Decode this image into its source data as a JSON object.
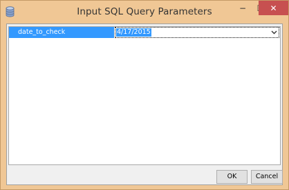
{
  "window": {
    "title": "Input SQL Query Parameters",
    "minimize_glyph": "−",
    "maximize_glyph": "☐",
    "close_glyph": "✕",
    "icon": "database-icon",
    "accent_color": "#f0c795"
  },
  "parameters": [
    {
      "name": "date_to_check",
      "value": "4/17/2015"
    }
  ],
  "buttons": {
    "ok_label": "OK",
    "cancel_label": "Cancel"
  },
  "colors": {
    "selection": "#3399ff",
    "close_button": "#c75050"
  }
}
